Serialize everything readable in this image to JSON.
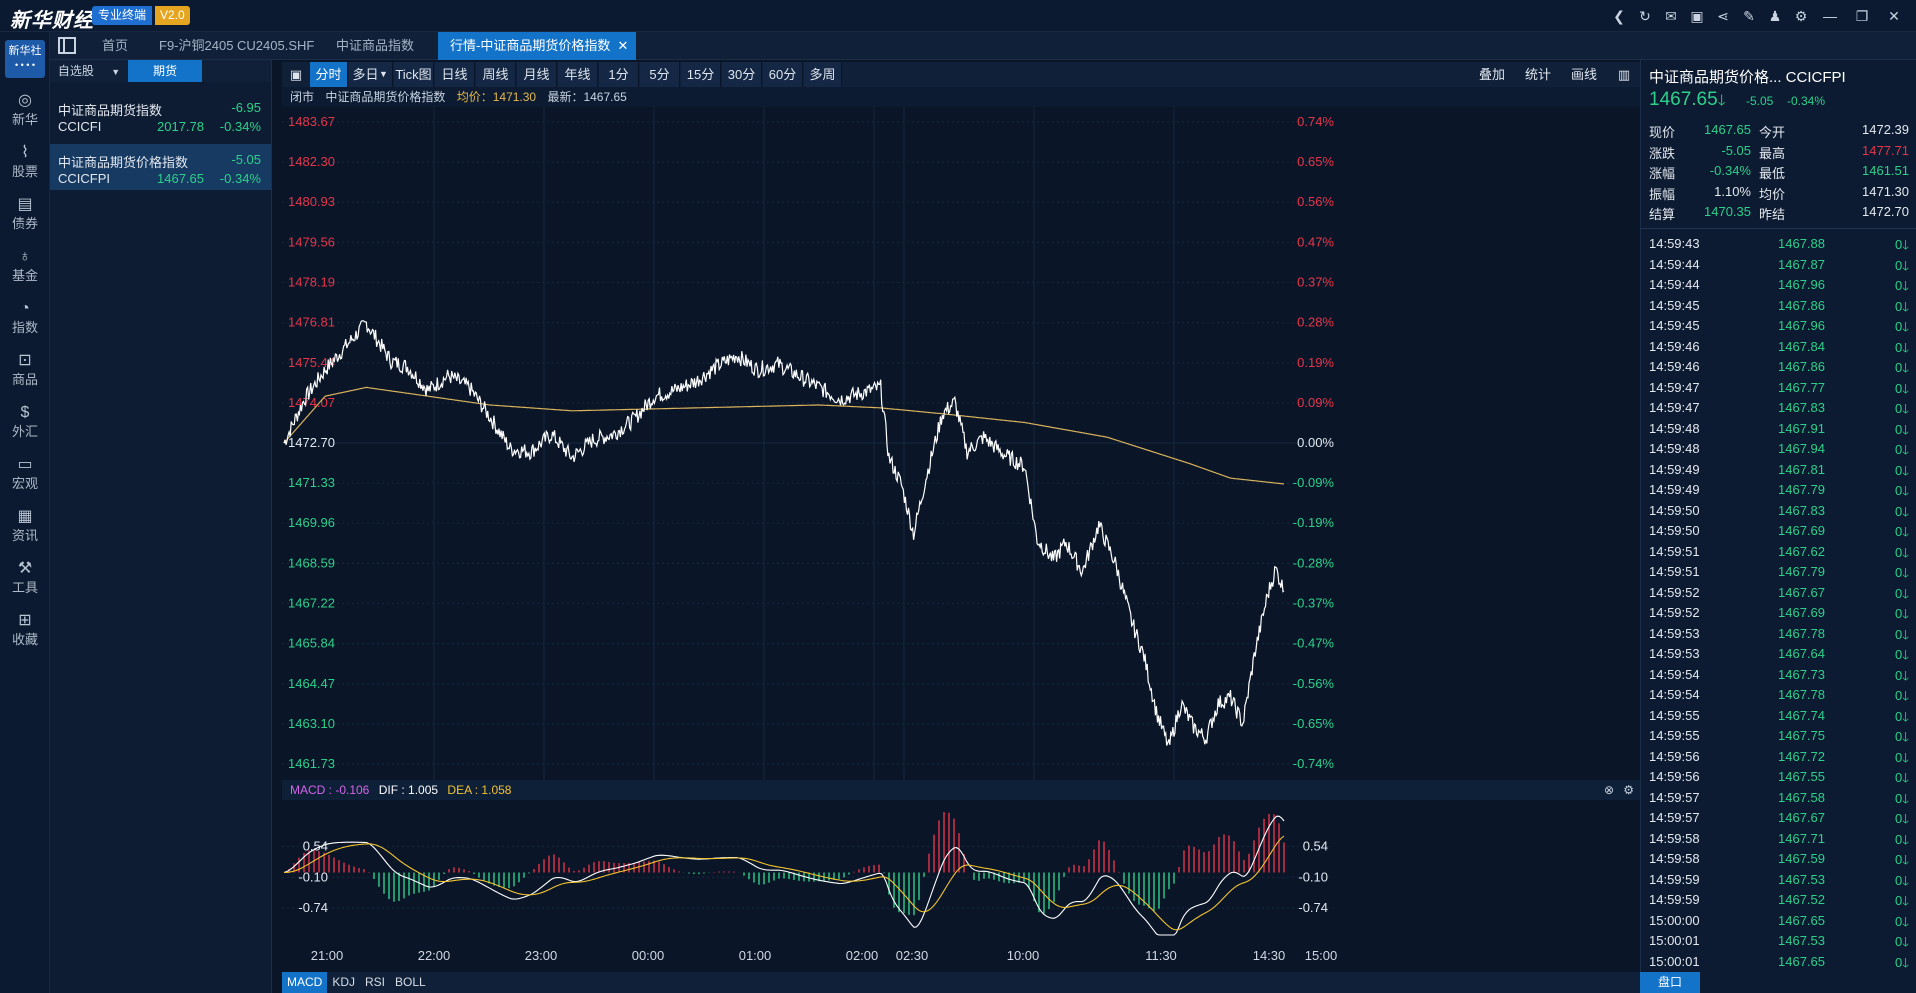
{
  "app": {
    "logo": "新华财经",
    "pro_badge": "专业终端",
    "version": "V2.0"
  },
  "title_icons": [
    "back-icon",
    "refresh-icon",
    "mail-icon",
    "chat-icon",
    "share-icon",
    "notes-icon",
    "skin-icon",
    "settings-icon",
    "minimize-icon",
    "restore-icon",
    "close-icon"
  ],
  "leftnav": {
    "brand": "新华社",
    "items": [
      {
        "label": "新华",
        "icon": "globe-icon",
        "glyph": "◎"
      },
      {
        "label": "股票",
        "icon": "stock-chart-icon",
        "glyph": "⌇"
      },
      {
        "label": "债券",
        "icon": "bond-icon",
        "glyph": "▤"
      },
      {
        "label": "基金",
        "icon": "fund-bag-icon",
        "glyph": "♁"
      },
      {
        "label": "指数",
        "icon": "index-icon",
        "glyph": "◔"
      },
      {
        "label": "商品",
        "icon": "commodity-icon",
        "glyph": "⊡"
      },
      {
        "label": "外汇",
        "icon": "forex-icon",
        "glyph": "$"
      },
      {
        "label": "宏观",
        "icon": "macro-icon",
        "glyph": "▭"
      },
      {
        "label": "资讯",
        "icon": "news-icon",
        "glyph": "▦"
      },
      {
        "label": "工具",
        "icon": "tools-icon",
        "glyph": "⚒"
      },
      {
        "label": "收藏",
        "icon": "favorites-icon",
        "glyph": "⊞"
      }
    ]
  },
  "tabs": [
    "首页",
    "F9-沪铜2405 CU2405.SHF",
    "中证商品指数",
    "行情-中证商品期货价格指数"
  ],
  "watchlist": {
    "tabs": [
      "自选股",
      "期货"
    ],
    "rows": [
      {
        "name": "中证商品期货指数",
        "change": "-6.95",
        "code": "CCICFI",
        "price": "2017.78",
        "pct": "-0.34%"
      },
      {
        "name": "中证商品期货价格指数",
        "change": "-5.05",
        "code": "CCICFPI",
        "price": "1467.65",
        "pct": "-0.34%"
      }
    ]
  },
  "toolbar": {
    "periods": [
      "分时",
      "多日",
      "Tick图",
      "日线",
      "周线",
      "月线",
      "年线",
      "1分",
      "5分",
      "15分",
      "30分",
      "60分",
      "多周期"
    ],
    "right": [
      "叠加",
      "统计",
      "画线"
    ]
  },
  "infobar": {
    "status": "闭市",
    "name": "中证商品期货价格指数",
    "avg": "均价：1471.30",
    "last": "最新：1467.65"
  },
  "macd": {
    "label": "MACD : -0.106",
    "dif": "DIF : 1.005",
    "dea": "DEA : 1.058"
  },
  "indicators": [
    "MACD",
    "KDJ",
    "RSI",
    "BOLL"
  ],
  "quote": {
    "title": "中证商品期货价格...  CCICFPI",
    "last": "1467.65",
    "change": "-5.05",
    "pct": "-0.34%",
    "fields": [
      [
        "现价",
        "1467.65",
        "今开",
        "1472.39"
      ],
      [
        "涨跌",
        "-5.05",
        "最高",
        "1477.71"
      ],
      [
        "涨幅",
        "-0.34%",
        "最低",
        "1461.51"
      ],
      [
        "振幅",
        "1.10%",
        "均价",
        "1471.30"
      ],
      [
        "结算",
        "1470.35",
        "昨结",
        "1472.70"
      ]
    ],
    "ticks": [
      [
        "14:59:43",
        "1467.88"
      ],
      [
        "14:59:44",
        "1467.87"
      ],
      [
        "14:59:44",
        "1467.96"
      ],
      [
        "14:59:45",
        "1467.86"
      ],
      [
        "14:59:45",
        "1467.96"
      ],
      [
        "14:59:46",
        "1467.84"
      ],
      [
        "14:59:46",
        "1467.86"
      ],
      [
        "14:59:47",
        "1467.77"
      ],
      [
        "14:59:47",
        "1467.83"
      ],
      [
        "14:59:48",
        "1467.91"
      ],
      [
        "14:59:48",
        "1467.94"
      ],
      [
        "14:59:49",
        "1467.81"
      ],
      [
        "14:59:49",
        "1467.79"
      ],
      [
        "14:59:50",
        "1467.83"
      ],
      [
        "14:59:50",
        "1467.69"
      ],
      [
        "14:59:51",
        "1467.62"
      ],
      [
        "14:59:51",
        "1467.79"
      ],
      [
        "14:59:52",
        "1467.67"
      ],
      [
        "14:59:52",
        "1467.69"
      ],
      [
        "14:59:53",
        "1467.78"
      ],
      [
        "14:59:53",
        "1467.64"
      ],
      [
        "14:59:54",
        "1467.73"
      ],
      [
        "14:59:54",
        "1467.78"
      ],
      [
        "14:59:55",
        "1467.74"
      ],
      [
        "14:59:55",
        "1467.75"
      ],
      [
        "14:59:56",
        "1467.72"
      ],
      [
        "14:59:56",
        "1467.55"
      ],
      [
        "14:59:57",
        "1467.58"
      ],
      [
        "14:59:57",
        "1467.67"
      ],
      [
        "14:59:58",
        "1467.71"
      ],
      [
        "14:59:58",
        "1467.59"
      ],
      [
        "14:59:59",
        "1467.53"
      ],
      [
        "14:59:59",
        "1467.52"
      ],
      [
        "15:00:00",
        "1467.65"
      ],
      [
        "15:00:01",
        "1467.53"
      ],
      [
        "15:00:01",
        "1467.65"
      ]
    ],
    "tick_volume": "0",
    "pankou": "盘口"
  },
  "chart_data": {
    "type": "line",
    "y_ticks": [
      "1483.67",
      "1482.30",
      "1480.93",
      "1479.56",
      "1478.19",
      "1476.81",
      "1475.44",
      "1474.07",
      "1472.70",
      "1471.33",
      "1469.96",
      "1468.59",
      "1467.22",
      "1465.84",
      "1464.47",
      "1463.10",
      "1461.73"
    ],
    "pct_ticks": [
      "0.74%",
      "0.65%",
      "0.56%",
      "0.47%",
      "0.37%",
      "0.28%",
      "0.19%",
      "0.09%",
      "0.00%",
      "-0.09%",
      "-0.19%",
      "-0.28%",
      "-0.37%",
      "-0.47%",
      "-0.56%",
      "-0.65%",
      "-0.74%"
    ],
    "ylim": [
      1461.73,
      1483.67
    ],
    "prev_settle": 1472.7,
    "x_labels": [
      "21:00",
      "22:00",
      "23:00",
      "00:00",
      "01:00",
      "02:00",
      "02:30",
      "10:00",
      "11:30",
      "14:30",
      "15:00"
    ],
    "price_anchors": [
      [
        0,
        1472.7
      ],
      [
        0.5,
        1474.2
      ],
      [
        1,
        1475.2
      ],
      [
        1.5,
        1476.0
      ],
      [
        2,
        1476.8
      ],
      [
        2.6,
        1475.5
      ],
      [
        3,
        1475.3
      ],
      [
        3.5,
        1474.5
      ],
      [
        4,
        1475.0
      ],
      [
        4.5,
        1474.6
      ],
      [
        5,
        1473.6
      ],
      [
        5.5,
        1472.5
      ],
      [
        6,
        1472.4
      ],
      [
        6.5,
        1473.0
      ],
      [
        7,
        1472.2
      ],
      [
        7.5,
        1472.8
      ],
      [
        8,
        1473.0
      ],
      [
        8.5,
        1473.5
      ],
      [
        9,
        1474.3
      ],
      [
        9.5,
        1474.5
      ],
      [
        10,
        1474.8
      ],
      [
        10.5,
        1475.3
      ],
      [
        11,
        1475.7
      ],
      [
        11.5,
        1475.2
      ],
      [
        12,
        1475.4
      ],
      [
        12.5,
        1475.0
      ],
      [
        13,
        1474.6
      ],
      [
        13.5,
        1474.2
      ],
      [
        14,
        1474.4
      ],
      [
        14.5,
        1474.6
      ],
      [
        14.7,
        1472.2
      ],
      [
        15,
        1471.3
      ],
      [
        15.3,
        1469.6
      ],
      [
        15.6,
        1471.5
      ],
      [
        16,
        1473.7
      ],
      [
        16.3,
        1474.1
      ],
      [
        16.6,
        1472.4
      ],
      [
        17,
        1472.9
      ],
      [
        17.5,
        1472.3
      ],
      [
        18,
        1471.9
      ],
      [
        18.3,
        1469.4
      ],
      [
        18.7,
        1468.7
      ],
      [
        19,
        1469.3
      ],
      [
        19.4,
        1468.3
      ],
      [
        19.8,
        1469.9
      ],
      [
        20.2,
        1468.6
      ],
      [
        20.6,
        1466.6
      ],
      [
        20.9,
        1465.4
      ],
      [
        21.2,
        1463.5
      ],
      [
        21.5,
        1462.3
      ],
      [
        21.8,
        1463.8
      ],
      [
        22.1,
        1463.0
      ],
      [
        22.4,
        1462.6
      ],
      [
        22.7,
        1463.8
      ],
      [
        23,
        1464.0
      ],
      [
        23.3,
        1463.1
      ],
      [
        23.6,
        1465.6
      ],
      [
        23.9,
        1467.5
      ],
      [
        24.1,
        1468.4
      ],
      [
        24.3,
        1467.65
      ]
    ],
    "avg_anchors": [
      [
        0,
        1472.7
      ],
      [
        1,
        1474.3
      ],
      [
        2,
        1474.6
      ],
      [
        3,
        1474.4
      ],
      [
        5,
        1474.0
      ],
      [
        7,
        1473.8
      ],
      [
        10,
        1473.9
      ],
      [
        13,
        1474.0
      ],
      [
        14.5,
        1473.9
      ],
      [
        16,
        1473.7
      ],
      [
        18,
        1473.4
      ],
      [
        20,
        1472.9
      ],
      [
        22,
        1472.0
      ],
      [
        23,
        1471.5
      ],
      [
        24.3,
        1471.3
      ]
    ],
    "macd_ticks": [
      "0.54",
      "-0.10",
      "-0.74"
    ],
    "macd_ylim": [
      -1.3,
      1.3
    ]
  },
  "colors": {
    "up": "#e6344a",
    "down": "#2dd08a",
    "price_line": "#ffffff",
    "avg_line": "#d9b25b",
    "dea_line": "#f2c230",
    "macd_label": "#d565e8"
  }
}
